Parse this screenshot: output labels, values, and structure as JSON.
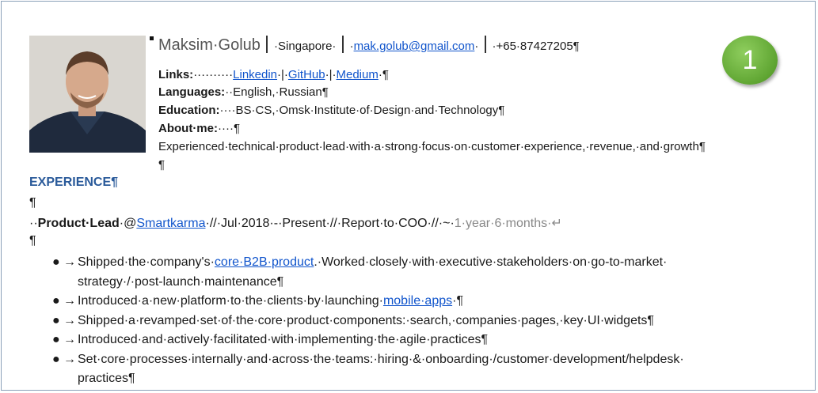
{
  "header": {
    "name": "Maksim·Golub",
    "location": "·Singapore·",
    "email": "mak.golub@gmail.com",
    "phone": "·+65·87427205¶"
  },
  "links": {
    "label": "Links:",
    "spacer": "··········",
    "linkedin": "Linkedin",
    "sep1": "·|·",
    "github": "GitHub",
    "sep2": "·|·",
    "medium": "Medium",
    "end": "·¶"
  },
  "languages": {
    "label": "Languages:",
    "value": "··English,·Russian¶"
  },
  "education": {
    "label": "Education:",
    "value": "····BS·CS,·Omsk·Institute·of·Design·and·Technology¶"
  },
  "about": {
    "label": "About·me:",
    "tail": "····¶",
    "text": "Experienced·technical·product·lead·with·a·strong·focus·on·customer·experience,·revenue,·and·growth¶",
    "blank": "¶"
  },
  "experience": {
    "heading": "EXPERIENCE¶",
    "blank1": "¶",
    "job_prefix": "··",
    "job_title": "Product·Lead",
    "job_at": "·@",
    "company": "Smartkarma",
    "job_details": "·//·Jul·2018·-·Present·//·Report·to·COO·//·~·",
    "duration": "1·year·6·months·↵",
    "blank2": "¶",
    "bullets": [
      {
        "pre": "Shipped·the·company's·",
        "link": "core·B2B·product",
        "post": ".·Worked·closely·with·executive·stakeholders·on·go-to-market·",
        "cont": "strategy·/·post-launch·maintenance¶"
      },
      {
        "pre": "Introduced·a·new·platform·to·the·clients·by·launching·",
        "link": "mobile·apps",
        "post": "·¶",
        "cont": ""
      },
      {
        "pre": "Shipped·a·revamped·set·of·the·core·product·components:·search,·companies·pages,·key·UI·widgets¶",
        "link": "",
        "post": "",
        "cont": ""
      },
      {
        "pre": "Introduced·and·actively·facilitated·with·implementing·the·agile·practices¶",
        "link": "",
        "post": "",
        "cont": ""
      },
      {
        "pre": "Set·core·processes·internally·and·across·the·teams:·hiring·&·onboarding·/customer·development/helpdesk·",
        "link": "",
        "post": "",
        "cont": "practices¶"
      }
    ],
    "bullet_glyph": "●",
    "arrow_glyph": "→"
  },
  "badge": {
    "number": "1",
    "color": "#6ab33c"
  }
}
